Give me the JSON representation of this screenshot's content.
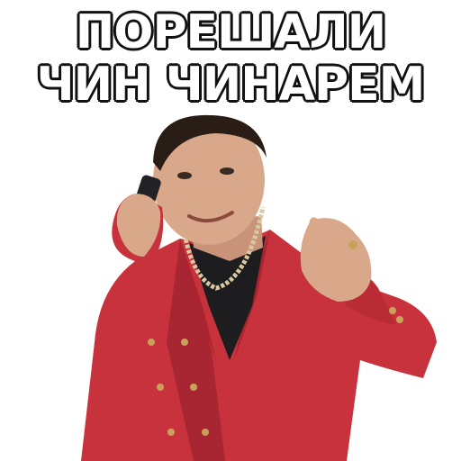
{
  "caption": {
    "line1": "ПОРЕШАЛИ",
    "line2": "ЧИН ЧИНАРЕМ"
  },
  "colors": {
    "background": "#ffffff",
    "jacket": "#c8323c",
    "jacket_shadow": "#8e1e28",
    "skin": "#d9a88a",
    "hair": "#2a1d16",
    "shirt": "#1d1d1f",
    "chain": "#d8c9a0",
    "phone": "#222226",
    "buttons": "#c9a25a",
    "text_fill": "#ffffff",
    "text_stroke": "#111111"
  }
}
